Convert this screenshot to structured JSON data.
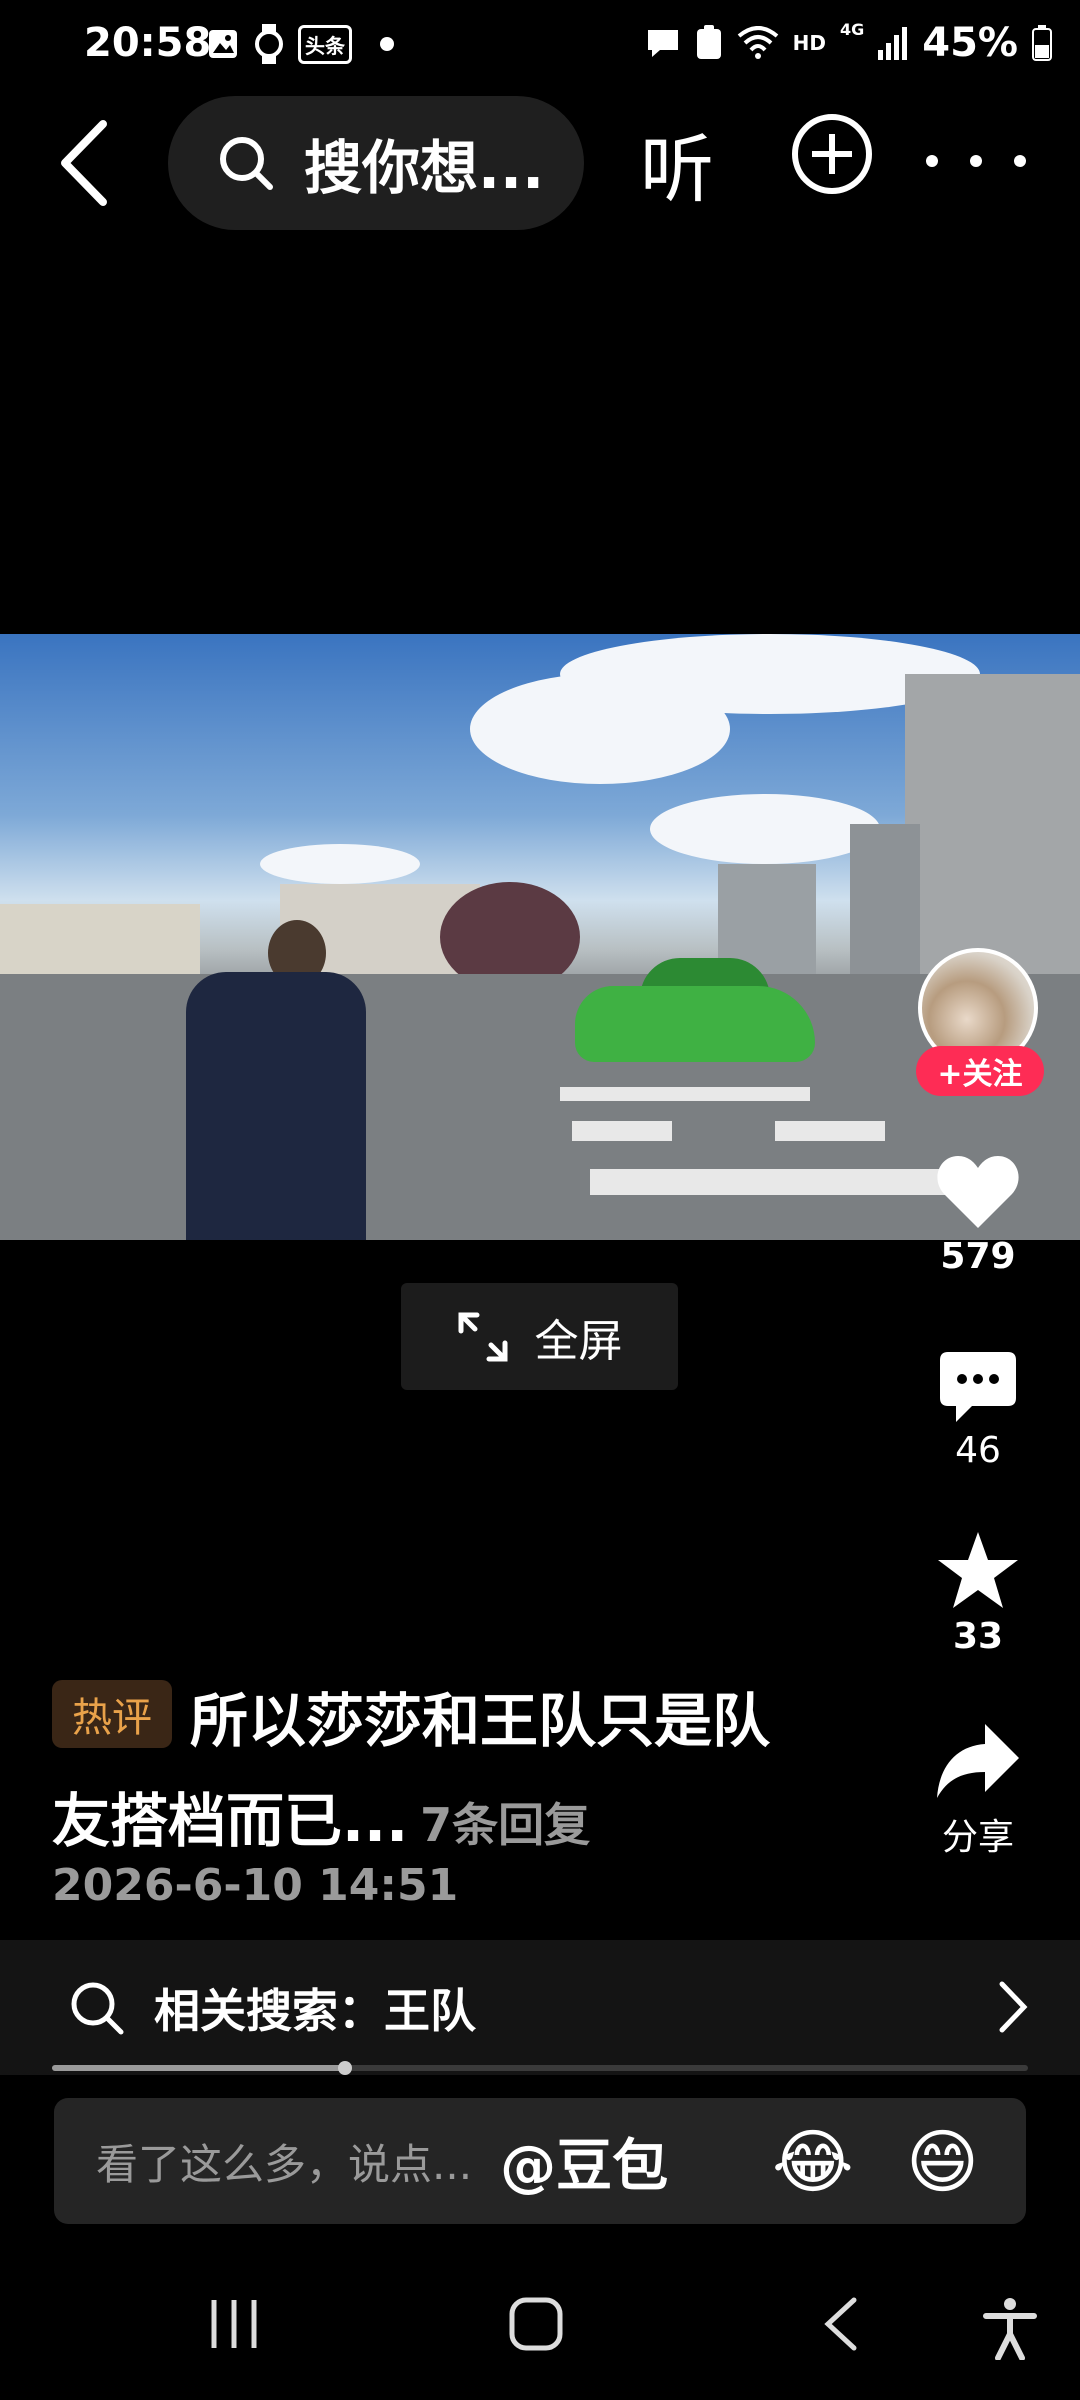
{
  "status_bar": {
    "time": "20:58",
    "left_icons": [
      "image-icon",
      "watch-icon",
      "toutiao-icon",
      "dot-icon"
    ],
    "app_badge": "头条",
    "right_icons": [
      "message-icon",
      "clipboard-icon",
      "wifi-icon",
      "signal-icon",
      "battery-icon"
    ],
    "hd_label": "HD",
    "network_label": "4G",
    "battery": "45%"
  },
  "top_bar": {
    "search_placeholder": "搜你想...",
    "listen_label": "听"
  },
  "video": {
    "fullscreen_label": "全屏"
  },
  "author": {
    "follow_label": "+关注"
  },
  "actions": {
    "likes": "579",
    "comments": "46",
    "favorites": "33",
    "share_label": "分享"
  },
  "hot_comment": {
    "badge": "热评",
    "line1": "所以莎莎和王队只是队",
    "line2": "友搭档而已...",
    "replies": "7条回复",
    "date": "2026-6-10 14:51"
  },
  "related_search": {
    "text": "相关搜索：王队"
  },
  "progress": {
    "fraction": 0.3
  },
  "comment_input": {
    "placeholder": "看了这么多，说点...",
    "mention": "@豆包",
    "emoji_1": "😂",
    "emoji_2": "😄"
  },
  "colors": {
    "background": "#000000",
    "follow": "#fe2c55",
    "hot_badge_text": "#e9a24a"
  }
}
